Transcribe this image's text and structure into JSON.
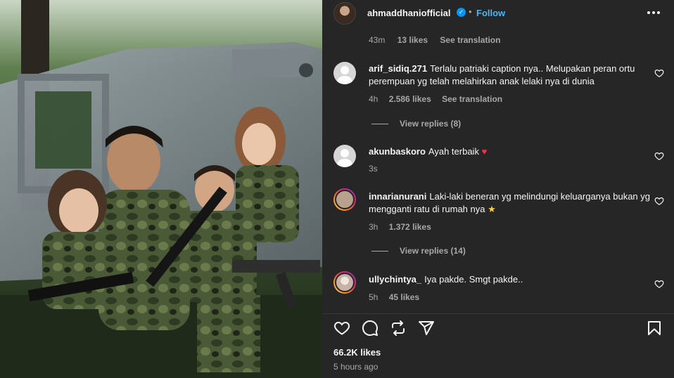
{
  "post": {
    "username": "ahmaddhaniofficial",
    "verified_mark": "✓",
    "separator": "•",
    "follow_label": "Follow",
    "caption_age": "43m",
    "caption_likes": "13 likes",
    "see_translation": "See translation"
  },
  "comments": [
    {
      "username": "arif_sidiq.271",
      "text": "Terlalu patriaki caption nya.. Melupakan peran ortu perempuan yg telah melahirkan anak lelaki nya di dunia",
      "age": "4h",
      "likes": "2.586 likes",
      "see_translation": "See translation",
      "replies": "View replies (8)",
      "avatar": "default-avatar"
    },
    {
      "username": "akunbaskoro",
      "text": "Ayah terbaik",
      "emoji": "♥",
      "age": "3s",
      "avatar": "default-avatar"
    },
    {
      "username": "innarianurani",
      "text": "Laki-laki beneran yg melindungi keluarganya bukan yg mengganti ratu di rumah nya",
      "emoji": "★",
      "age": "3h",
      "likes": "1.372 likes",
      "replies": "View replies (14)",
      "avatar": "story-avatar"
    },
    {
      "username": "ullychintya_",
      "text": "Iya pakde. Smgt pakde..",
      "age": "5h",
      "likes": "45 likes",
      "avatar": "story-avatar"
    }
  ],
  "footer": {
    "likes": "66.2K likes",
    "time_ago": "5 hours ago"
  },
  "icons": [
    "more-icon",
    "heart-icon",
    "comment-icon",
    "repost-icon",
    "share-icon",
    "bookmark-icon"
  ],
  "colors": {
    "background": "#262626",
    "link": "#4cb5f9",
    "verified": "#0095f6",
    "muted": "#a8a8a8",
    "heart": "#ff3040"
  }
}
